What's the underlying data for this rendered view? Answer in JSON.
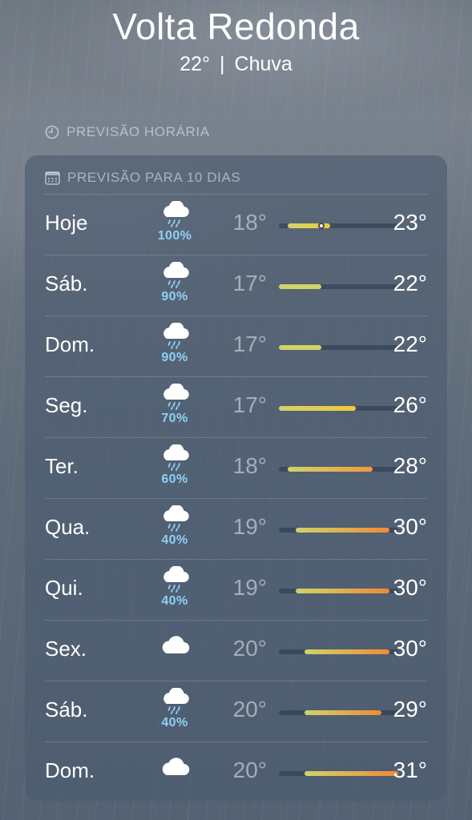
{
  "header": {
    "city": "Volta Redonda",
    "temperature": "22°",
    "separator": "|",
    "condition": "Chuva"
  },
  "hourly": {
    "title": "PREVISÃO HORÁRIA",
    "icon": "clock-icon"
  },
  "daily": {
    "title": "PREVISÃO PARA 10 DIAS",
    "icon": "calendar-icon",
    "range_min": 17,
    "range_max": 31,
    "current_temp_value": 22,
    "days": [
      {
        "day": "Hoje",
        "icon": "rain-cloud-icon",
        "precip": "100%",
        "low": "18°",
        "high": "23°",
        "low_v": 18,
        "high_v": 23,
        "current": true
      },
      {
        "day": "Sáb.",
        "icon": "rain-cloud-icon",
        "precip": "90%",
        "low": "17°",
        "high": "22°",
        "low_v": 17,
        "high_v": 22
      },
      {
        "day": "Dom.",
        "icon": "rain-cloud-icon",
        "precip": "90%",
        "low": "17°",
        "high": "22°",
        "low_v": 17,
        "high_v": 22
      },
      {
        "day": "Seg.",
        "icon": "rain-cloud-icon",
        "precip": "70%",
        "low": "17°",
        "high": "26°",
        "low_v": 17,
        "high_v": 26
      },
      {
        "day": "Ter.",
        "icon": "rain-cloud-icon",
        "precip": "60%",
        "low": "18°",
        "high": "28°",
        "low_v": 18,
        "high_v": 28
      },
      {
        "day": "Qua.",
        "icon": "rain-cloud-icon",
        "precip": "40%",
        "low": "19°",
        "high": "30°",
        "low_v": 19,
        "high_v": 30
      },
      {
        "day": "Qui.",
        "icon": "rain-cloud-icon",
        "precip": "40%",
        "low": "19°",
        "high": "30°",
        "low_v": 19,
        "high_v": 30
      },
      {
        "day": "Sex.",
        "icon": "cloud-icon",
        "precip": "",
        "low": "20°",
        "high": "30°",
        "low_v": 20,
        "high_v": 30
      },
      {
        "day": "Sáb.",
        "icon": "rain-cloud-icon",
        "precip": "40%",
        "low": "20°",
        "high": "29°",
        "low_v": 20,
        "high_v": 29
      },
      {
        "day": "Dom.",
        "icon": "cloud-icon",
        "precip": "",
        "low": "20°",
        "high": "31°",
        "low_v": 20,
        "high_v": 31
      }
    ]
  },
  "colors": {
    "precip": "#8fd0f7",
    "bar_cool": "#cfd46a",
    "bar_mid": "#f2c83a",
    "bar_warm": "#f19a3a",
    "bar_hot": "#ef8a35"
  }
}
